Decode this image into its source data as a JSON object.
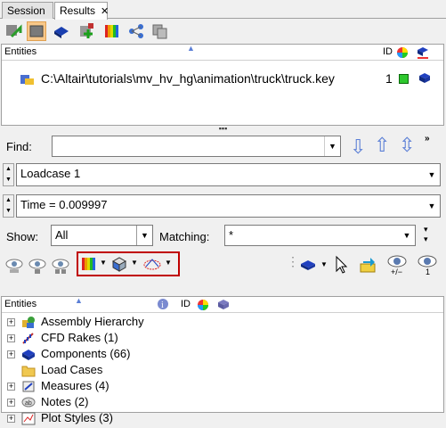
{
  "tabs": [
    {
      "label": "Session"
    },
    {
      "label": "Results",
      "close": "✕"
    }
  ],
  "entities_panel": {
    "header": {
      "entities": "Entities",
      "id": "ID"
    },
    "row": {
      "path": "C:\\Altair\\tutorials\\mv_hv_hg\\animation\\truck\\truck.key",
      "id": "1"
    }
  },
  "splitter": "▪▪▪",
  "find": {
    "label": "Find:",
    "value": ""
  },
  "loadcase": {
    "value": "Loadcase 1"
  },
  "time": {
    "value": "Time = 0.009997"
  },
  "show": {
    "label": "Show:",
    "value": "All"
  },
  "matching": {
    "label": "Matching:",
    "value": "*"
  },
  "tree": {
    "header": "Entities",
    "id_header": "ID",
    "items": [
      {
        "label": "Assembly Hierarchy",
        "icon": "assembly-icon"
      },
      {
        "label": "CFD Rakes (1)",
        "icon": "cfd-rake-icon"
      },
      {
        "label": "Components (66)",
        "icon": "component-icon"
      },
      {
        "label": "Load Cases",
        "icon": "folder-icon"
      },
      {
        "label": "Measures (4)",
        "icon": "measure-icon"
      },
      {
        "label": "Notes (2)",
        "icon": "note-icon"
      },
      {
        "label": "Plot Styles (3)",
        "icon": "plot-style-icon"
      }
    ]
  },
  "colors": {
    "accent_blue": "#5b7fd6",
    "highlight_red": "#c00000",
    "pressed": "#f8c88a"
  }
}
